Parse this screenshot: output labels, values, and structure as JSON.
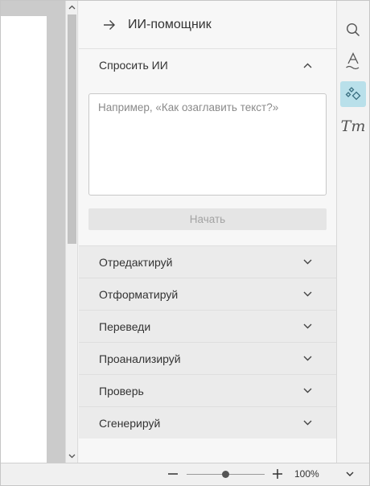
{
  "panel": {
    "title": "ИИ-помощник",
    "ask_section": {
      "label": "Спросить ИИ",
      "placeholder": "Например, «Как озаглавить текст?»",
      "start_label": "Начать"
    },
    "sections": [
      {
        "label": "Отредактируй"
      },
      {
        "label": "Отформатируй"
      },
      {
        "label": "Переведи"
      },
      {
        "label": "Проанализируй"
      },
      {
        "label": "Проверь"
      },
      {
        "label": "Сгенерируй"
      }
    ]
  },
  "toolbar": {
    "tools": [
      {
        "icon": "search-icon"
      },
      {
        "icon": "text-art-icon"
      },
      {
        "icon": "ai-assistant-icon",
        "active": true
      },
      {
        "icon": "text-style-icon",
        "glyph": "Tт"
      }
    ]
  },
  "status": {
    "zoom": "100%",
    "zoom_fraction": 0.5
  },
  "colors": {
    "accent": "#b9e0ea",
    "panel_bg": "#f7f7f7",
    "section_bg": "#ebebeb"
  }
}
